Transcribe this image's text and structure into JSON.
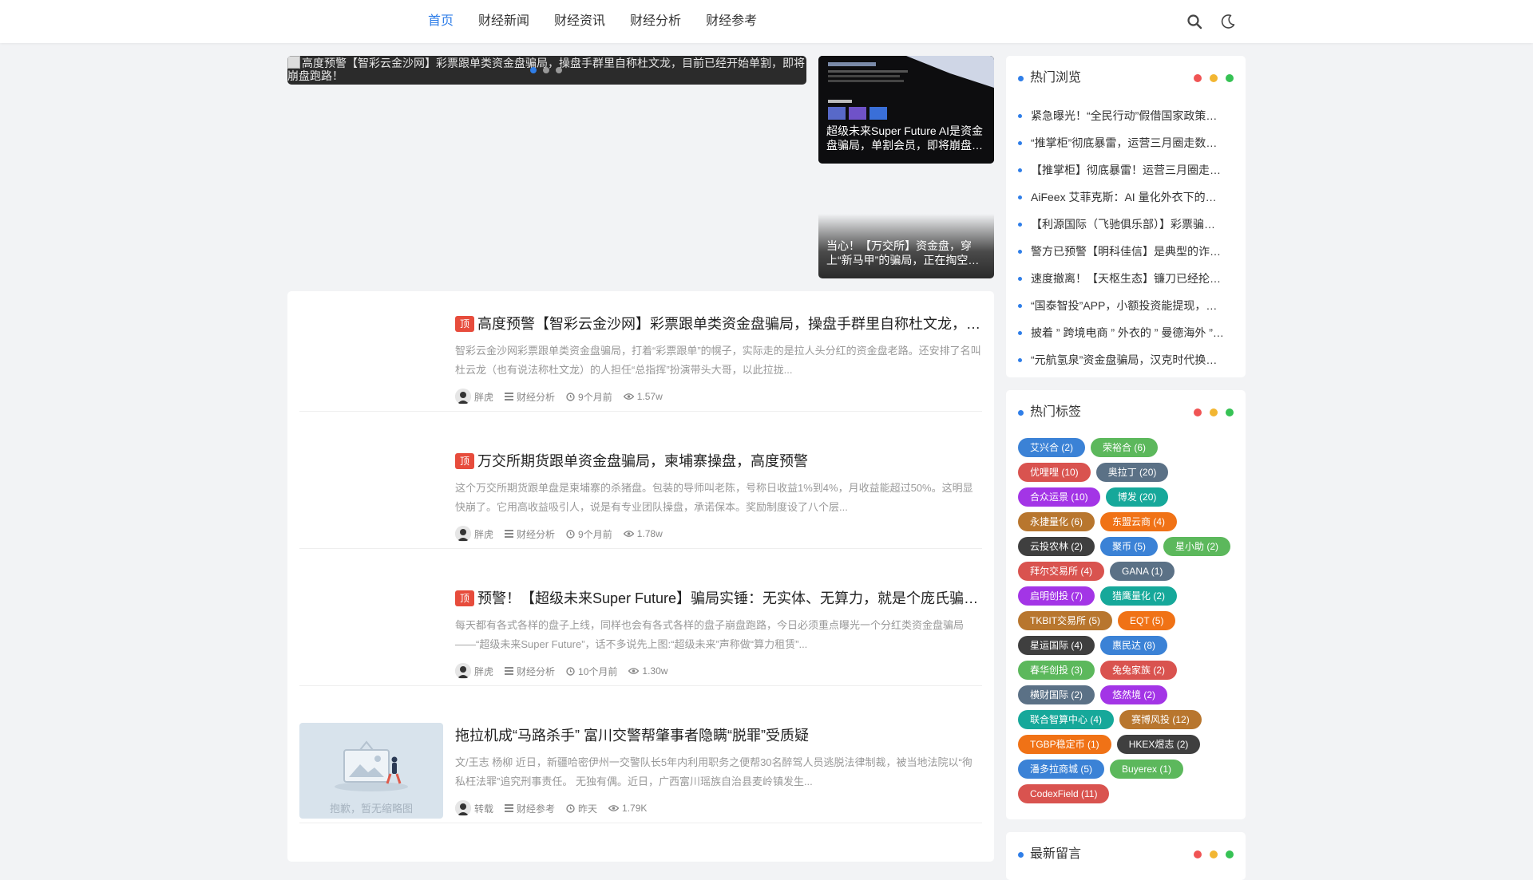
{
  "nav": {
    "items": [
      {
        "label": "首页",
        "active": true
      },
      {
        "label": "财经新闻"
      },
      {
        "label": "财经资讯"
      },
      {
        "label": "财经分析"
      },
      {
        "label": "财经参考"
      }
    ],
    "icons": [
      "search-icon",
      "moon-icon"
    ]
  },
  "slider": {
    "broken_image_alt": "高度预警【智彩云金沙网】彩票跟单类资金盘骗局，操盘手群里自称杜文龙，目前已经开始单割，即将崩盘跑路！",
    "dots": 3,
    "active_dot": 0
  },
  "side_cards": [
    {
      "caption": "超级未来Super Future AI是资金盘骗局，单割会员，即将崩盘跑路"
    },
    {
      "caption": "当心！【万交所】资金盘，穿上“新马甲”的骗局，正在掏空投资者"
    }
  ],
  "articles": [
    {
      "pinned_label": "顶",
      "title": "高度预警【智彩云金沙网】彩票跟单类资金盘骗局，操盘手群里自称杜文龙，目前已经开始单割，即将崩盘跑路！",
      "excerpt": "智彩云金沙网彩票跟单类资金盘骗局，打着“彩票跟单”的幌子，实际走的是拉人头分红的资金盘老路。还安排了名叫杜云龙（也有说法称杜文龙）的人担任“总指挥”扮演带头大哥，以此拉拢...",
      "author": "胖虎",
      "category": "财经分析",
      "time": "9个月前",
      "views": "1.57w"
    },
    {
      "pinned_label": "顶",
      "title": "万交所期货跟单资金盘骗局，柬埔寨操盘，高度预警",
      "excerpt": "这个万交所期货跟单盘是柬埔寨的杀猪盘。包装的导师叫老陈，号称日收益1%到4%，月收益能超过50%。这明显快崩了。它用高收益吸引人，说是有专业团队操盘，承诺保本。奖励制度设了八个层...",
      "author": "胖虎",
      "category": "财经分析",
      "time": "9个月前",
      "views": "1.78w"
    },
    {
      "pinned_label": "顶",
      "title": "预警！【超级未来Super Future】骗局实锤：无实体、无算力，就是个庞氏骗局！",
      "excerpt": "每天都有各式各样的盘子上线，同样也会有各式各样的盘子崩盘跑路，今日必须重点曝光一个分红类资金盘骗局——“超级未来Super Future”，话不多说先上图:“超级未来”声称做“算力租赁”...",
      "author": "胖虎",
      "category": "财经分析",
      "time": "10个月前",
      "views": "1.30w"
    },
    {
      "title": "拖拉机成“马路杀手” 富川交警帮肇事者隐瞒“脱罪”受质疑",
      "excerpt": "文/王志  杨柳 近日，新疆哈密伊州一交警队长5年内利用职务之便帮30名醉驾人员逃脱法律制裁，被当地法院以“徇私枉法罪”追究刑事责任。 无独有偶。近日，广西富川瑶族自治县麦岭镇发生...",
      "author": "转载",
      "category": "财经参考",
      "time": "昨天",
      "views": "1.79K",
      "placeholder_text": "抱歉，暂无缩略图"
    }
  ],
  "hot_browse": {
    "title": "热门浏览",
    "items": [
      "紧急曝光！“全民行动”假借国家政策之名，实为资金盘骗局",
      "“推掌柜”彻底暴雷，运营三月圈走数亿资金",
      "【推掌柜】彻底暴雷！运营三月圈走数亿，受害者维权无门",
      "AiFeex 艾菲克斯：AI 量化外衣下的资金盘骗局",
      "【利源国际（飞驰俱乐部）】彩票骗局曝光",
      "警方已预警【明科佳信】是典型的诈骗资金盘",
      "速度撤离！【天枢生态】镰刀已经抡起，即将崩盘",
      "“国泰智投”APP，小额投资能提现，大额投资被冻结",
      "披着 ” 跨境电商 ” 外衣的 ” 曼德海外 ” 资金盘骗局",
      "“元航氢泉”资金盘骗局，汉克时代换皮重来"
    ]
  },
  "hot_tags": {
    "title": "热门标签",
    "tags": [
      {
        "label": "艾兴合 (2)",
        "color": "#3b82d6"
      },
      {
        "label": "荣裕合 (6)",
        "color": "#5cb85c"
      },
      {
        "label": "优哩哩 (10)",
        "color": "#d9534f"
      },
      {
        "label": "奥拉丁 (20)",
        "color": "#5b7186"
      },
      {
        "label": "合众运景 (10)",
        "color": "#a335e6"
      },
      {
        "label": "博发 (20)",
        "color": "#16a89a"
      },
      {
        "label": "永捷量化 (6)",
        "color": "#b8762e"
      },
      {
        "label": "东盟云商 (4)",
        "color": "#f07216"
      },
      {
        "label": "云投农林 (2)",
        "color": "#3f3f3f"
      },
      {
        "label": "聚币 (5)",
        "color": "#3b82d6"
      },
      {
        "label": "星小助 (2)",
        "color": "#5cb85c"
      },
      {
        "label": "拜尔交易所 (4)",
        "color": "#d9534f"
      },
      {
        "label": "GANA (1)",
        "color": "#5b7186"
      },
      {
        "label": "启明创投 (7)",
        "color": "#a335e6"
      },
      {
        "label": "猎鹰量化 (2)",
        "color": "#16a89a"
      },
      {
        "label": "TKBIT交易所 (5)",
        "color": "#b8762e"
      },
      {
        "label": "EQT (5)",
        "color": "#f07216"
      },
      {
        "label": "星运国际 (4)",
        "color": "#3f3f3f"
      },
      {
        "label": "惠民达 (8)",
        "color": "#3b82d6"
      },
      {
        "label": "春华创投 (3)",
        "color": "#5cb85c"
      },
      {
        "label": "兔兔家族 (2)",
        "color": "#d9534f"
      },
      {
        "label": "横财国际 (2)",
        "color": "#5b7186"
      },
      {
        "label": "悠然境 (2)",
        "color": "#a335e6"
      },
      {
        "label": "联合智算中心 (4)",
        "color": "#16a89a"
      },
      {
        "label": "赛博风投 (12)",
        "color": "#b8762e"
      },
      {
        "label": "TGBP稳定币 (1)",
        "color": "#f07216"
      },
      {
        "label": "HKEX煜志 (2)",
        "color": "#3f3f3f"
      },
      {
        "label": "潘多拉商城 (5)",
        "color": "#3b82d6"
      },
      {
        "label": "Buyerex (1)",
        "color": "#5cb85c"
      },
      {
        "label": "CodexField (11)",
        "color": "#d9534f"
      }
    ]
  },
  "latest_comments": {
    "title": "最新留言"
  },
  "colors": {
    "accent": "#2f7ee8",
    "widget_dots": [
      "#f05454",
      "#f2b632",
      "#36c254"
    ]
  }
}
